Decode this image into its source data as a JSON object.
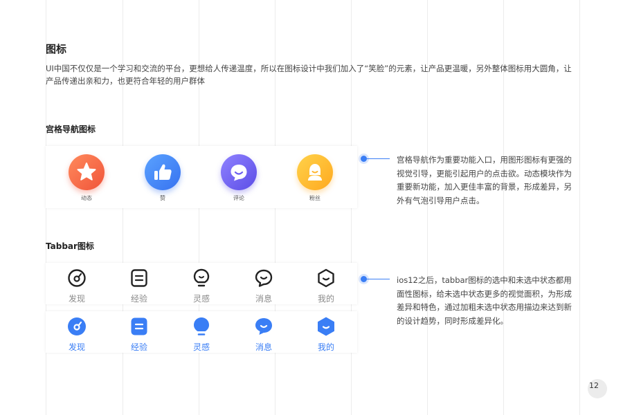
{
  "header": {
    "title": "图标",
    "intro": "UI中国不仅仅是一个学习和交流的平台，更想给人传递温度，所以在图标设计中我们加入了“笑脸”的元素，让产品更温暖，另外整体图标用大圆角，让产品传递出亲和力，也更符合年轻的用户群体"
  },
  "grid_nav": {
    "title": "宫格导航图标",
    "items": [
      {
        "label": "动态",
        "icon": "star-icon",
        "color_from": "#ff8a5c",
        "color_to": "#f0543a"
      },
      {
        "label": "赞",
        "icon": "thumbs-up-icon",
        "color_from": "#5aa2ff",
        "color_to": "#3772f0"
      },
      {
        "label": "评论",
        "icon": "chat-bubble-icon",
        "color_from": "#8f82ff",
        "color_to": "#5c4de6"
      },
      {
        "label": "粉丝",
        "icon": "fan-avatar-icon",
        "color_from": "#ffd24a",
        "color_to": "#ffa91f"
      }
    ],
    "description": "宫格导航作为重要功能入口，用图形图标有更强的视觉引导，更能引起用户的点击欲。动态模块作为重要新功能，加入更佳丰富的背景，形成差异，另外有气泡引导用户点击。"
  },
  "tabbar": {
    "title": "Tabbar图标",
    "items": [
      {
        "label": "发现",
        "icon": "discover-icon"
      },
      {
        "label": "经验",
        "icon": "document-icon"
      },
      {
        "label": "灵感",
        "icon": "lightbulb-icon"
      },
      {
        "label": "消息",
        "icon": "message-icon"
      },
      {
        "label": "我的",
        "icon": "profile-hexagon-icon"
      }
    ],
    "description": "ios12之后，tabbar图标的选中和未选中状态都用面性图标，给未选中状态更多的视觉面积，为形成差异和特色，通过加粗未选中状态用描边来达到新的设计趋势，同时形成差异化。"
  },
  "colors": {
    "accent": "#3a7ef5",
    "inactive_label": "#8a8a8a",
    "inactive_stroke": "#222222"
  },
  "page": {
    "number": "12"
  }
}
